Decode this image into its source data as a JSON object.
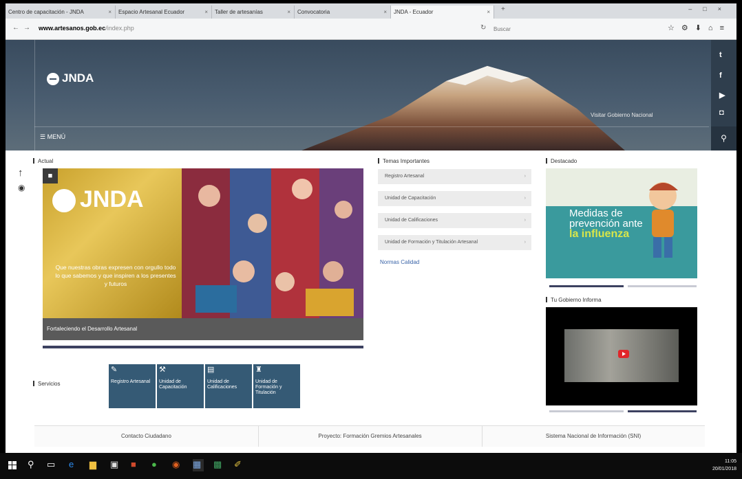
{
  "browser": {
    "tabs": [
      {
        "title": "Centro de capacitación - JNDA"
      },
      {
        "title": "Espacio Artesanal Ecuador"
      },
      {
        "title": "Taller de artesanías"
      },
      {
        "title": "Convocatoria"
      },
      {
        "title": "JNDA - Ecuador",
        "active": true
      }
    ],
    "address": {
      "domain": "www.artesanos.gob.ec",
      "path": "/index.php"
    },
    "search_placeholder": "Buscar"
  },
  "header": {
    "logo_text": "JNDA",
    "menu_label": "☰ MENÚ",
    "gov_link": "Visitar Gobierno Nacional",
    "social": [
      "twitter-icon",
      "facebook-icon",
      "youtube-icon",
      "instagram-icon"
    ]
  },
  "sections": {
    "actual": "Actual",
    "temas": "Temas Importantes",
    "destacados": "Destacado",
    "gobierno": "Tu Gobierno Informa",
    "servicios": "Servicios"
  },
  "slider": {
    "logo_text": "JNDA",
    "quote": "Que nuestras obras expresen con orgullo todo lo que sabemos y que inspiren a los presentes y futuros",
    "caption": "Fortaleciendo el Desarrollo Artesanal"
  },
  "accordion": {
    "items": [
      "Registro Artesanal",
      "Unidad de Capacitación",
      "Unidad de Calificaciones",
      "Unidad de Formación y Titulación Artesanal"
    ],
    "link": "Normas Calidad"
  },
  "promo": {
    "line1": "Medidas de",
    "line2": "prevención ante",
    "line3": "la influenza"
  },
  "services": [
    {
      "label": "Registro Artesanal",
      "icon": "wrench-icon"
    },
    {
      "label": "Unidad de Capacitación",
      "icon": "hammer-icon"
    },
    {
      "label": "Unidad de Calificaciones",
      "icon": "document-icon"
    },
    {
      "label": "Unidad de Formación y Titulación",
      "icon": "graduate-icon"
    }
  ],
  "footer_tabs": [
    "Contacto Ciudadano",
    "Proyecto: Formación Gremios Artesanales",
    "Sistema Nacional de Información (SNI)"
  ],
  "taskbar": {
    "time": "11:05",
    "date": "20/01/2018"
  },
  "colors": {
    "header": "#3f5064",
    "services": "#355a75",
    "promo": "#3a9a9d",
    "accent": "#d8e64a"
  }
}
